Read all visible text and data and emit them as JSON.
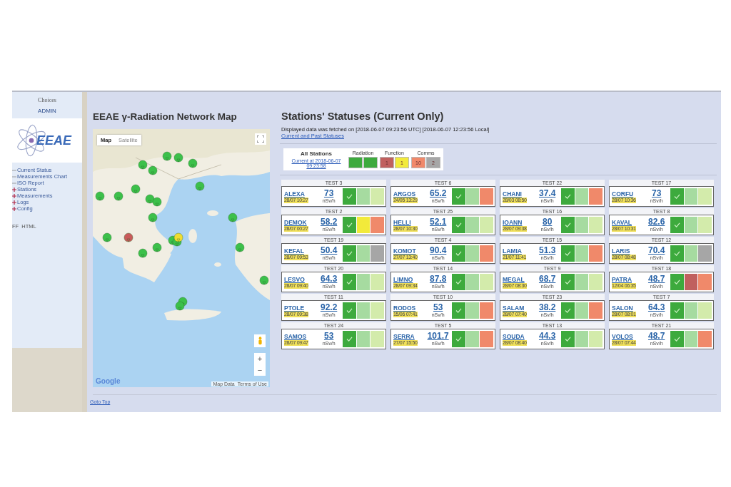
{
  "sidebar": {
    "heading": "Choices",
    "user": "ADMIN",
    "logo_text": "EEAE",
    "menu": [
      {
        "label": "Current Status",
        "expandable": false
      },
      {
        "label": "Measurements Chart",
        "expandable": false
      },
      {
        "label": "ISO Report",
        "expandable": false
      },
      {
        "label": "Stations",
        "expandable": true
      },
      {
        "label": "Measurements",
        "expandable": true
      },
      {
        "label": "Logs",
        "expandable": true
      },
      {
        "label": "Config",
        "expandable": true
      }
    ],
    "footer": "FF  HTML"
  },
  "map": {
    "title": "EEAE γ-Radiation Network Map",
    "map_types": [
      {
        "label": "Map",
        "selected": true
      },
      {
        "label": "Satellite",
        "selected": false
      }
    ],
    "zoom_in": "+",
    "zoom_out": "−",
    "brand": "Google",
    "map_data": "Map Data",
    "terms": "Terms of Use"
  },
  "statuses": {
    "title": "Stations' Statuses (Current Only)",
    "fetched": "Displayed data was fetched on [2018-06-07 09:23:56 UTC] [2018-06-07 12:23:56 Local]",
    "history_link": "Current and Past Statuses",
    "summary": {
      "title": "All Stations",
      "link": "Current at 2018-06-07 09:23:58",
      "groups": [
        {
          "header": "Radiation",
          "cells": [
            {
              "color": "#3daa3d"
            },
            {
              "color": "#3daa3d"
            }
          ]
        },
        {
          "header": "Function",
          "cells": [
            {
              "color": "#c0605e",
              "count": "1"
            },
            {
              "color": "#f2ea3a",
              "count": "1"
            }
          ]
        },
        {
          "header": "Comms",
          "cells": [
            {
              "color": "#f0896a",
              "count": "10"
            },
            {
              "color": "#a6a6a6",
              "count": "2"
            }
          ]
        }
      ]
    },
    "stations": [
      {
        "test": "TEST 3",
        "name": "ALEXA",
        "date": "28/07 10:27",
        "value": "73",
        "unit": "nSv/h",
        "indicators": [
          {
            "color": "#3daa3d",
            "checked": true
          },
          {
            "color": "#a6dba0",
            "checked": false
          },
          {
            "color": "#d3ebab",
            "checked": false
          }
        ]
      },
      {
        "test": "TEST 6",
        "name": "ARGOS",
        "date": "24/05 13:29",
        "value": "65.2",
        "unit": "nSv/h",
        "indicators": [
          {
            "color": "#3daa3d",
            "checked": true
          },
          {
            "color": "#a6dba0",
            "checked": false
          },
          {
            "color": "#f0896a",
            "checked": false
          }
        ]
      },
      {
        "test": "TEST 22",
        "name": "CHANI",
        "date": "28/03 08:50",
        "value": "37.4",
        "unit": "nSv/h",
        "indicators": [
          {
            "color": "#3daa3d",
            "checked": true
          },
          {
            "color": "#a6dba0",
            "checked": false
          },
          {
            "color": "#f0896a",
            "checked": false
          }
        ]
      },
      {
        "test": "TEST 17",
        "name": "CORFU",
        "date": "28/07 10:36",
        "value": "73",
        "unit": "nSv/h",
        "indicators": [
          {
            "color": "#3daa3d",
            "checked": true
          },
          {
            "color": "#a6dba0",
            "checked": false
          },
          {
            "color": "#d3ebab",
            "checked": false
          }
        ]
      },
      {
        "test": "TEST 2",
        "name": "DEMOK",
        "date": "28/07 00:27",
        "value": "58.2",
        "unit": "nSv/h",
        "indicators": [
          {
            "color": "#3daa3d",
            "checked": true
          },
          {
            "color": "#f2ea3a",
            "checked": false
          },
          {
            "color": "#f0896a",
            "checked": false
          }
        ]
      },
      {
        "test": "TEST 25",
        "name": "HELLI",
        "date": "28/07 10:30",
        "value": "52.1",
        "unit": "nSv/h",
        "indicators": [
          {
            "color": "#3daa3d",
            "checked": true
          },
          {
            "color": "#a6dba0",
            "checked": false
          },
          {
            "color": "#d3ebab",
            "checked": false
          }
        ]
      },
      {
        "test": "TEST 16",
        "name": "IOANN",
        "date": "28/07 09:38",
        "value": "80",
        "unit": "nSv/h",
        "indicators": [
          {
            "color": "#3daa3d",
            "checked": true
          },
          {
            "color": "#a6dba0",
            "checked": false
          },
          {
            "color": "#d3ebab",
            "checked": false
          }
        ]
      },
      {
        "test": "TEST 8",
        "name": "KAVAL",
        "date": "28/07 10:31",
        "value": "82.6",
        "unit": "nSv/h",
        "indicators": [
          {
            "color": "#3daa3d",
            "checked": true
          },
          {
            "color": "#a6dba0",
            "checked": false
          },
          {
            "color": "#d3ebab",
            "checked": false
          }
        ]
      },
      {
        "test": "TEST 19",
        "name": "KEFAL",
        "date": "28/07 09:53",
        "value": "50.4",
        "unit": "nSv/h",
        "indicators": [
          {
            "color": "#3daa3d",
            "checked": true
          },
          {
            "color": "#a6dba0",
            "checked": false
          },
          {
            "color": "#a6a6a6",
            "checked": false
          }
        ]
      },
      {
        "test": "TEST 4",
        "name": "KOMOT",
        "date": "27/07 13:40",
        "value": "90.4",
        "unit": "nSv/h",
        "indicators": [
          {
            "color": "#3daa3d",
            "checked": true
          },
          {
            "color": "#a6dba0",
            "checked": false
          },
          {
            "color": "#f0896a",
            "checked": false
          }
        ]
      },
      {
        "test": "TEST 15",
        "name": "LAMIA",
        "date": "21/07 11:41",
        "value": "51.3",
        "unit": "nSv/h",
        "indicators": [
          {
            "color": "#3daa3d",
            "checked": true
          },
          {
            "color": "#a6dba0",
            "checked": false
          },
          {
            "color": "#f0896a",
            "checked": false
          }
        ]
      },
      {
        "test": "TEST 12",
        "name": "LARIS",
        "date": "28/07 08:48",
        "value": "70.4",
        "unit": "nSv/h",
        "indicators": [
          {
            "color": "#3daa3d",
            "checked": true
          },
          {
            "color": "#a6dba0",
            "checked": false
          },
          {
            "color": "#a6a6a6",
            "checked": false
          }
        ]
      },
      {
        "test": "TEST 20",
        "name": "LESVO",
        "date": "28/07 09:40",
        "value": "64.3",
        "unit": "nSv/h",
        "indicators": [
          {
            "color": "#3daa3d",
            "checked": true
          },
          {
            "color": "#a6dba0",
            "checked": false
          },
          {
            "color": "#d3ebab",
            "checked": false
          }
        ]
      },
      {
        "test": "TEST 14",
        "name": "LIMNO",
        "date": "28/07 09:34",
        "value": "87.8",
        "unit": "nSv/h",
        "indicators": [
          {
            "color": "#3daa3d",
            "checked": true
          },
          {
            "color": "#a6dba0",
            "checked": false
          },
          {
            "color": "#d3ebab",
            "checked": false
          }
        ]
      },
      {
        "test": "TEST 9",
        "name": "MEGAL",
        "date": "28/07 08:30",
        "value": "68.7",
        "unit": "nSv/h",
        "indicators": [
          {
            "color": "#3daa3d",
            "checked": true
          },
          {
            "color": "#a6dba0",
            "checked": false
          },
          {
            "color": "#d3ebab",
            "checked": false
          }
        ]
      },
      {
        "test": "TEST 18",
        "name": "PATRA",
        "date": "12/04 06:35",
        "value": "48.7",
        "unit": "nSv/h",
        "indicators": [
          {
            "color": "#3daa3d",
            "checked": true
          },
          {
            "color": "#c0605e",
            "checked": false
          },
          {
            "color": "#f0896a",
            "checked": false
          }
        ]
      },
      {
        "test": "TEST 11",
        "name": "PTOLE",
        "date": "28/07 09:38",
        "value": "92.2",
        "unit": "nSv/h",
        "indicators": [
          {
            "color": "#3daa3d",
            "checked": true
          },
          {
            "color": "#a6dba0",
            "checked": false
          },
          {
            "color": "#d3ebab",
            "checked": false
          }
        ]
      },
      {
        "test": "TEST 10",
        "name": "RODOS",
        "date": "15/06 07:41",
        "value": "53",
        "unit": "nSv/h",
        "indicators": [
          {
            "color": "#3daa3d",
            "checked": true
          },
          {
            "color": "#a6dba0",
            "checked": false
          },
          {
            "color": "#f0896a",
            "checked": false
          }
        ]
      },
      {
        "test": "TEST 23",
        "name": "SALAM",
        "date": "28/07 07:40",
        "value": "38.2",
        "unit": "nSv/h",
        "indicators": [
          {
            "color": "#3daa3d",
            "checked": true
          },
          {
            "color": "#a6dba0",
            "checked": false
          },
          {
            "color": "#f0896a",
            "checked": false
          }
        ]
      },
      {
        "test": "TEST 7",
        "name": "SALON",
        "date": "28/07 08:01",
        "value": "64.3",
        "unit": "nSv/h",
        "indicators": [
          {
            "color": "#3daa3d",
            "checked": true
          },
          {
            "color": "#a6dba0",
            "checked": false
          },
          {
            "color": "#d3ebab",
            "checked": false
          }
        ]
      },
      {
        "test": "TEST 24",
        "name": "SAMOS",
        "date": "28/07 09:47",
        "value": "53",
        "unit": "nSv/h",
        "indicators": [
          {
            "color": "#3daa3d",
            "checked": true
          },
          {
            "color": "#a6dba0",
            "checked": false
          },
          {
            "color": "#d3ebab",
            "checked": false
          }
        ]
      },
      {
        "test": "TEST 5",
        "name": "SERRA",
        "date": "27/07 15:50",
        "value": "101.7",
        "unit": "nSv/h",
        "indicators": [
          {
            "color": "#3daa3d",
            "checked": true
          },
          {
            "color": "#a6dba0",
            "checked": false
          },
          {
            "color": "#f0896a",
            "checked": false
          }
        ]
      },
      {
        "test": "TEST 13",
        "name": "SOUDA",
        "date": "28/07 08:40",
        "value": "44.3",
        "unit": "nSv/h",
        "indicators": [
          {
            "color": "#3daa3d",
            "checked": true
          },
          {
            "color": "#a6dba0",
            "checked": false
          },
          {
            "color": "#d3ebab",
            "checked": false
          }
        ]
      },
      {
        "test": "TEST 21",
        "name": "VOLOS",
        "date": "28/07 07:44",
        "value": "48.7",
        "unit": "nSv/h",
        "indicators": [
          {
            "color": "#3daa3d",
            "checked": true
          },
          {
            "color": "#a6dba0",
            "checked": false
          },
          {
            "color": "#f0896a",
            "checked": false
          }
        ]
      }
    ]
  },
  "footer_link": "Goto Top"
}
